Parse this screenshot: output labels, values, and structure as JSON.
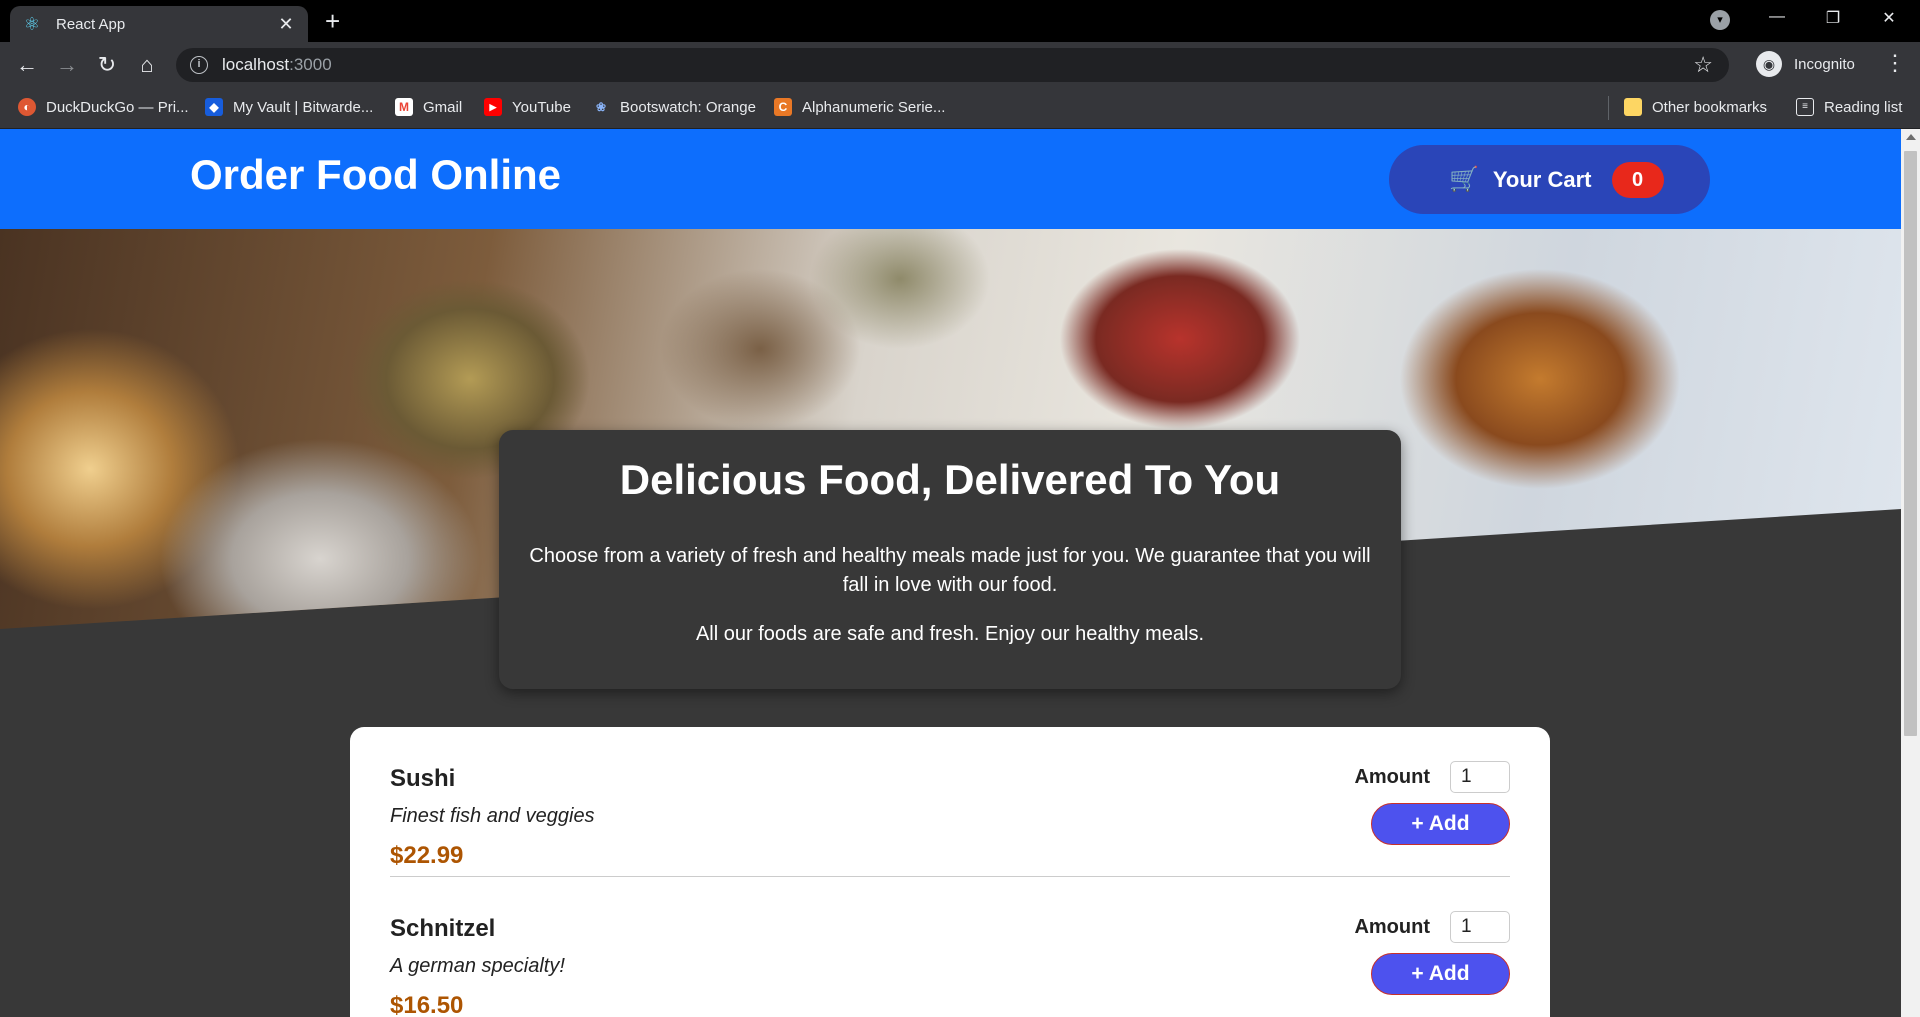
{
  "browser": {
    "tab_title": "React App",
    "url_host": "localhost",
    "url_port": ":3000",
    "profile_label": "Incognito",
    "bookmarks": [
      {
        "label": "DuckDuckGo — Pri...",
        "icon": "duckduckgo-icon",
        "color": "#de5833"
      },
      {
        "label": "My Vault | Bitwarde...",
        "icon": "bitwarden-icon",
        "color": "#175ddc"
      },
      {
        "label": "Gmail",
        "icon": "gmail-icon",
        "color": "#ea4335"
      },
      {
        "label": "YouTube",
        "icon": "youtube-icon",
        "color": "#ff0000"
      },
      {
        "label": "Bootswatch: Orange",
        "icon": "bootswatch-icon",
        "color": "#4285f4"
      },
      {
        "label": "Alphanumeric Serie...",
        "icon": "alphanumeric-icon",
        "color": "#e97826"
      }
    ],
    "other_bookmarks": "Other bookmarks",
    "reading_list": "Reading list"
  },
  "header": {
    "title": "Order Food Online",
    "cart_label": "Your Cart",
    "cart_count": "0"
  },
  "summary": {
    "title": "Delicious Food, Delivered To You",
    "paragraph1": "Choose from a variety of fresh and healthy meals made just for you. We guarantee that you will fall in love with our food.",
    "paragraph2": "All our foods are safe and fresh. Enjoy our healthy meals."
  },
  "meals": [
    {
      "name": "Sushi",
      "description": "Finest fish and veggies",
      "price": "$22.99",
      "amount_label": "Amount",
      "amount": "1",
      "add_label": "+ Add"
    },
    {
      "name": "Schnitzel",
      "description": "A german specialty!",
      "price": "$16.50",
      "amount_label": "Amount",
      "amount": "1",
      "add_label": "+ Add"
    }
  ],
  "colors": {
    "header": "#0d6efd",
    "cart_button": "#2a45b8",
    "badge": "#e8281b",
    "price": "#ad5502",
    "add_button": "#4d52ee"
  }
}
